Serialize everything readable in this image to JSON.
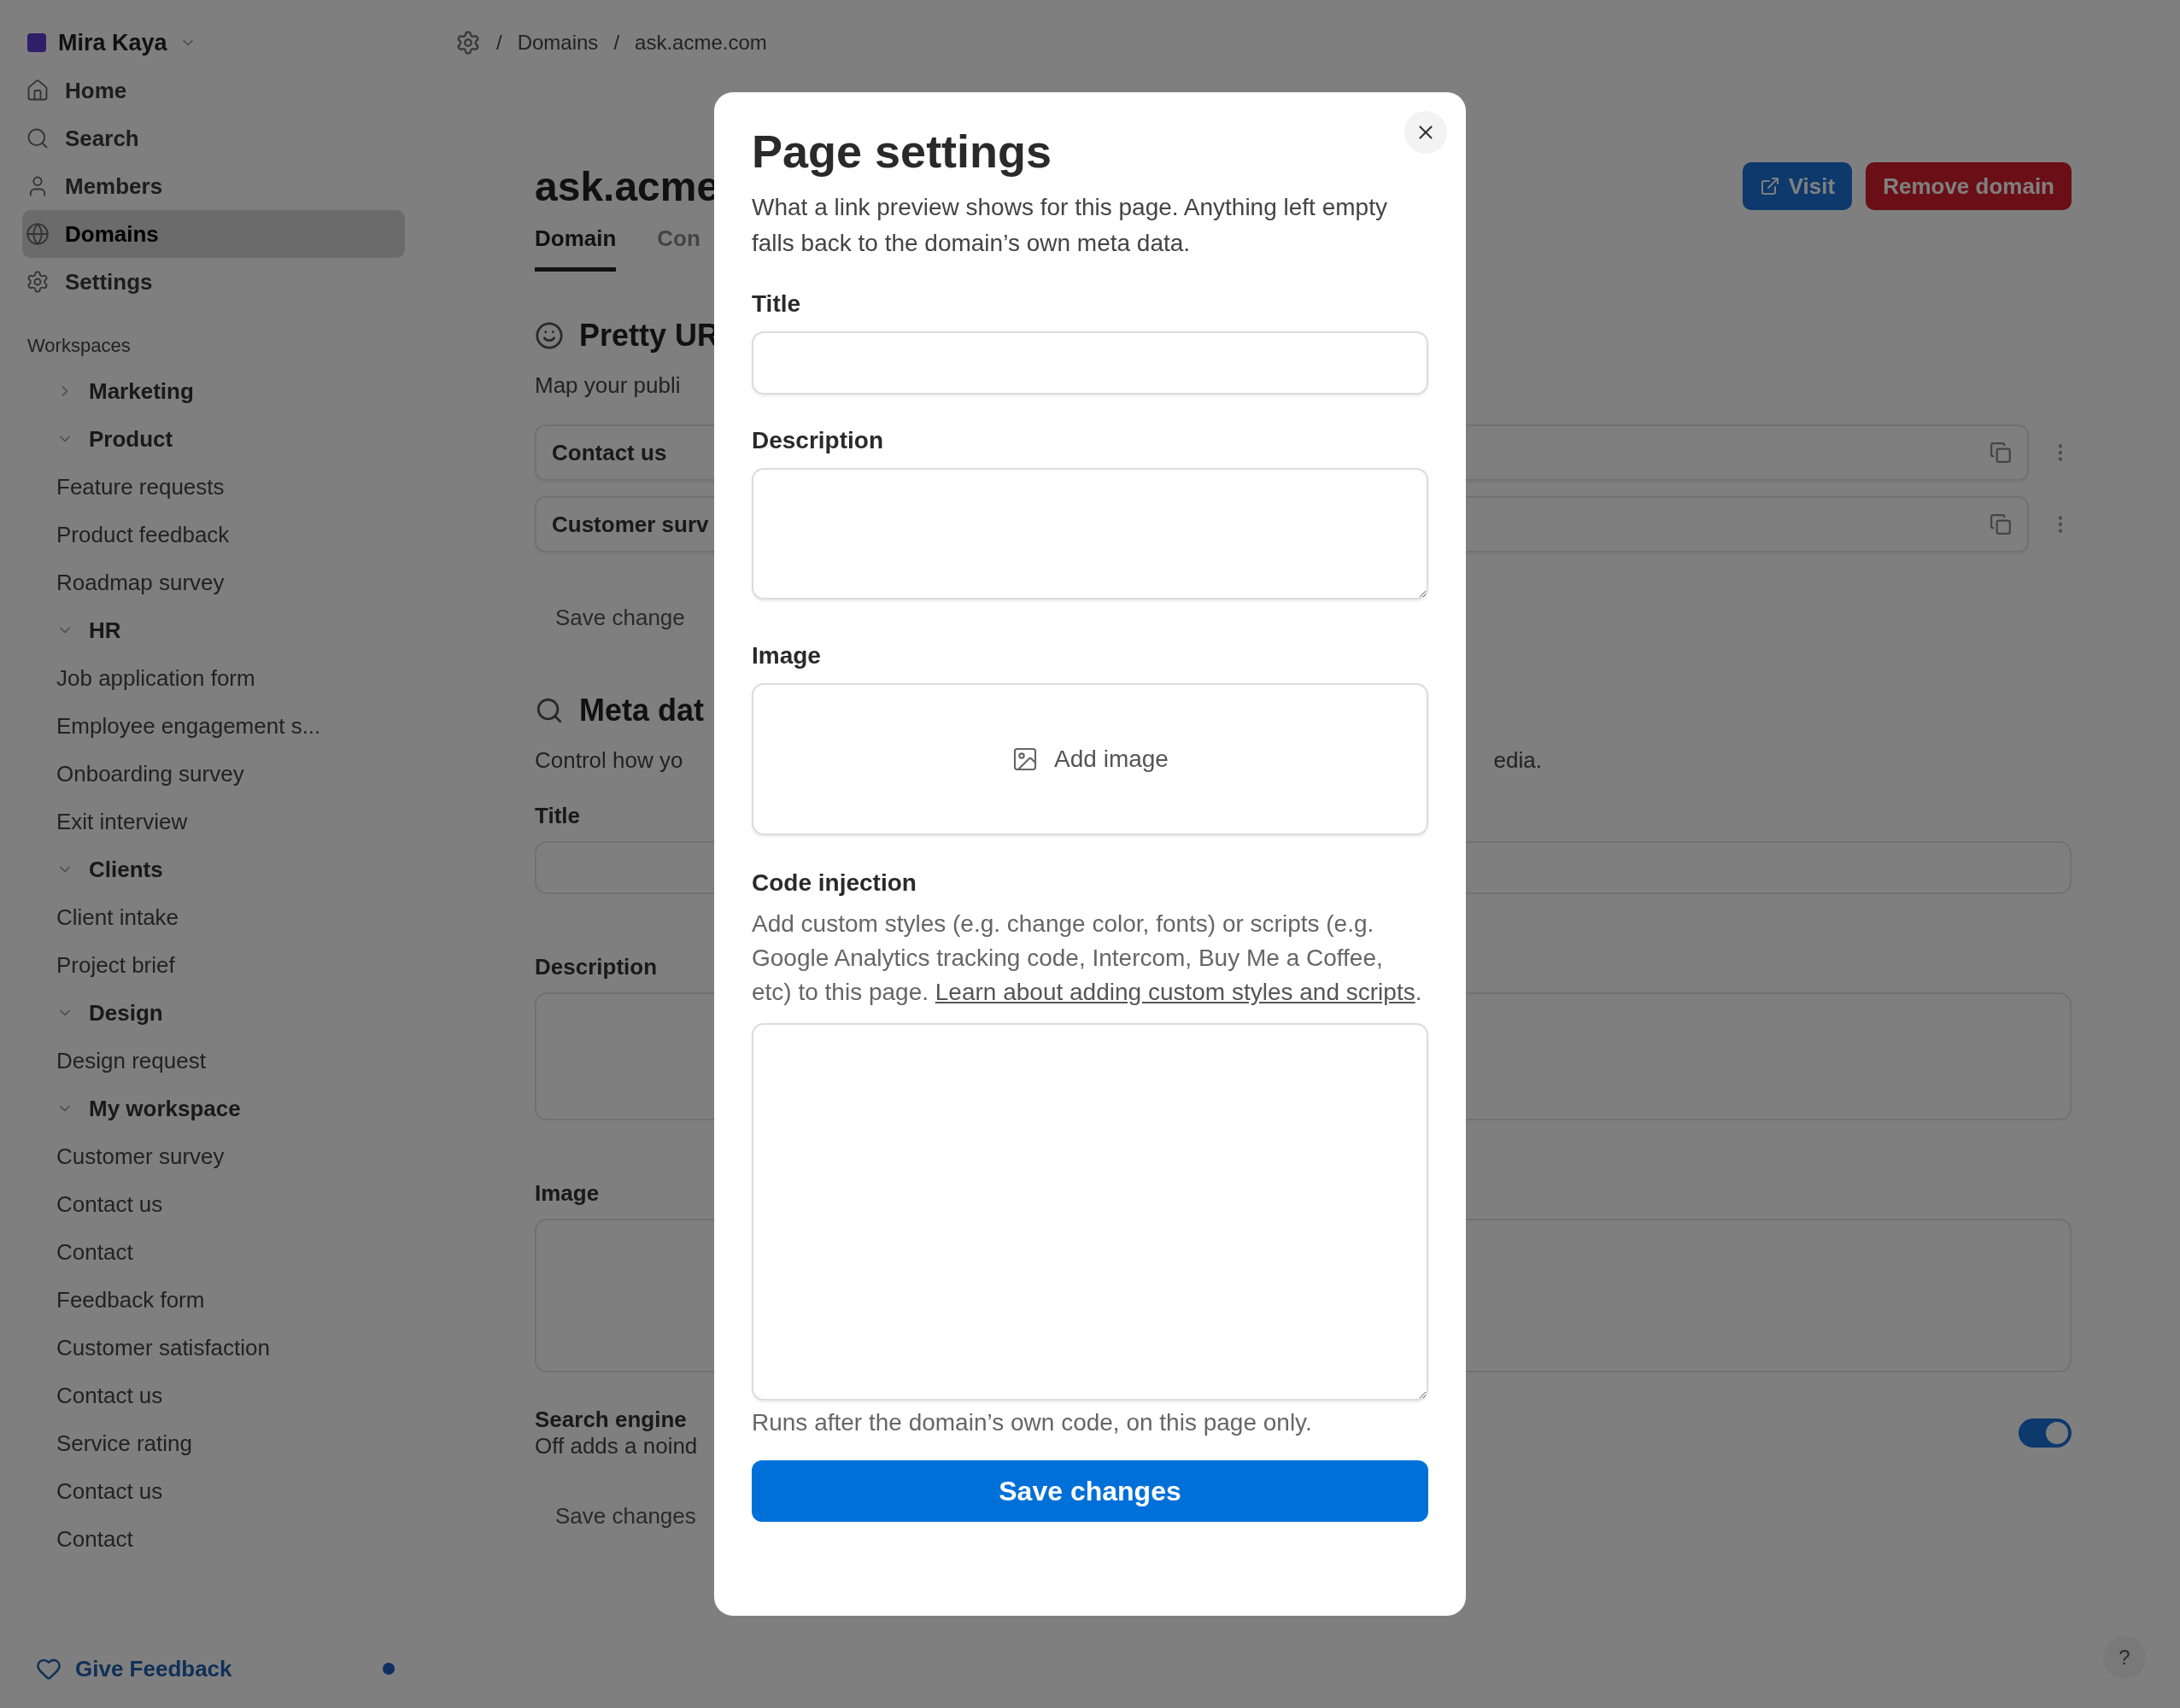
{
  "sidebar": {
    "account": {
      "name": "Mira Kaya"
    },
    "nav": [
      {
        "label": "Home",
        "selected": false
      },
      {
        "label": "Search",
        "selected": false
      },
      {
        "label": "Members",
        "selected": false
      },
      {
        "label": "Domains",
        "selected": true
      },
      {
        "label": "Settings",
        "selected": false
      }
    ],
    "section_title": "Workspaces",
    "workspaces": [
      {
        "label": "Marketing",
        "expanded": false
      },
      {
        "label": "Product",
        "expanded": true,
        "children": [
          {
            "label": "Feature requests"
          },
          {
            "label": "Product feedback"
          },
          {
            "label": "Roadmap survey"
          }
        ]
      },
      {
        "label": "HR",
        "expanded": true,
        "children": [
          {
            "label": "Job application form"
          },
          {
            "label": "Employee engagement s..."
          },
          {
            "label": "Onboarding survey"
          },
          {
            "label": "Exit interview"
          }
        ]
      },
      {
        "label": "Clients",
        "expanded": true,
        "children": [
          {
            "label": "Client intake"
          },
          {
            "label": "Project brief"
          }
        ]
      },
      {
        "label": "Design",
        "expanded": true,
        "children": [
          {
            "label": "Design request"
          }
        ]
      },
      {
        "label": "My workspace",
        "expanded": true,
        "children": [
          {
            "label": "Customer survey"
          },
          {
            "label": "Contact us"
          },
          {
            "label": "Contact"
          },
          {
            "label": "Feedback form"
          },
          {
            "label": "Customer satisfaction"
          },
          {
            "label": "Contact us"
          },
          {
            "label": "Service rating"
          },
          {
            "label": "Contact us"
          },
          {
            "label": "Contact"
          }
        ]
      }
    ],
    "feedback": {
      "label": "Give Feedback",
      "unread": true
    }
  },
  "breadcrumb": [
    {
      "separator": "/",
      "label": "Domains"
    },
    {
      "separator": "/",
      "label": "ask.acme.com"
    }
  ],
  "page": {
    "title": "ask.acme",
    "tabs": [
      {
        "label": "Domain",
        "selected": true
      },
      {
        "label": "Con",
        "selected": false
      }
    ],
    "actions": [
      {
        "label": "Visit",
        "kind": "primary"
      },
      {
        "label": "Remove domain",
        "kind": "danger"
      }
    ],
    "pretty_urls": {
      "heading": "Pretty UR",
      "description": "Map your publi",
      "rows": [
        {
          "page": "Contact us"
        },
        {
          "page": "Customer surv"
        }
      ],
      "save": {
        "label": "Save change",
        "disabled": true
      }
    },
    "meta_data": {
      "heading": "Meta dat",
      "description": "Control how yo",
      "description_end": "edia.",
      "fields": [
        {
          "label": "Title",
          "kind": "input"
        },
        {
          "label": "Description",
          "kind": "textarea"
        },
        {
          "label": "Image",
          "kind": "image"
        }
      ],
      "search_engine": {
        "title": "Search engine",
        "description": "Off adds a noind",
        "on": true
      },
      "save": {
        "label": "Save changes",
        "disabled": true
      }
    },
    "help_button": "?"
  },
  "dialog": {
    "title": "Page settings",
    "description": "What a link preview shows for this page. Anything left empty falls back to the domain’s own meta data.",
    "fields": [
      {
        "kind": "input",
        "label": "Title"
      },
      {
        "kind": "textarea",
        "label": "Description"
      },
      {
        "kind": "image",
        "label": "Image",
        "action": "Add image"
      },
      {
        "kind": "code",
        "label": "Code injection",
        "help": "Add custom styles (e.g. change color, fonts) or scripts (e.g. Google Analytics tracking code, Intercom, Buy Me a Coffee, etc) to this page.",
        "link": "Learn about adding custom styles and scripts",
        "help_end": ".",
        "hint": "Runs after the domain’s own code, on this page only."
      }
    ],
    "submit": "Save changes"
  }
}
